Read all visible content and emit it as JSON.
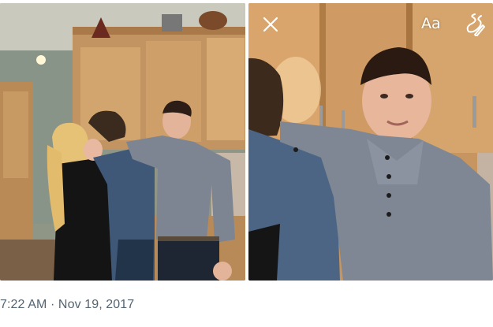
{
  "snapchat_overlay": {
    "close_icon": "close-icon",
    "text_tool_label": "Aa",
    "pen_icon": "pen-icon"
  },
  "tweet": {
    "timestamp": "7:22 AM · Nov 19, 2017"
  }
}
